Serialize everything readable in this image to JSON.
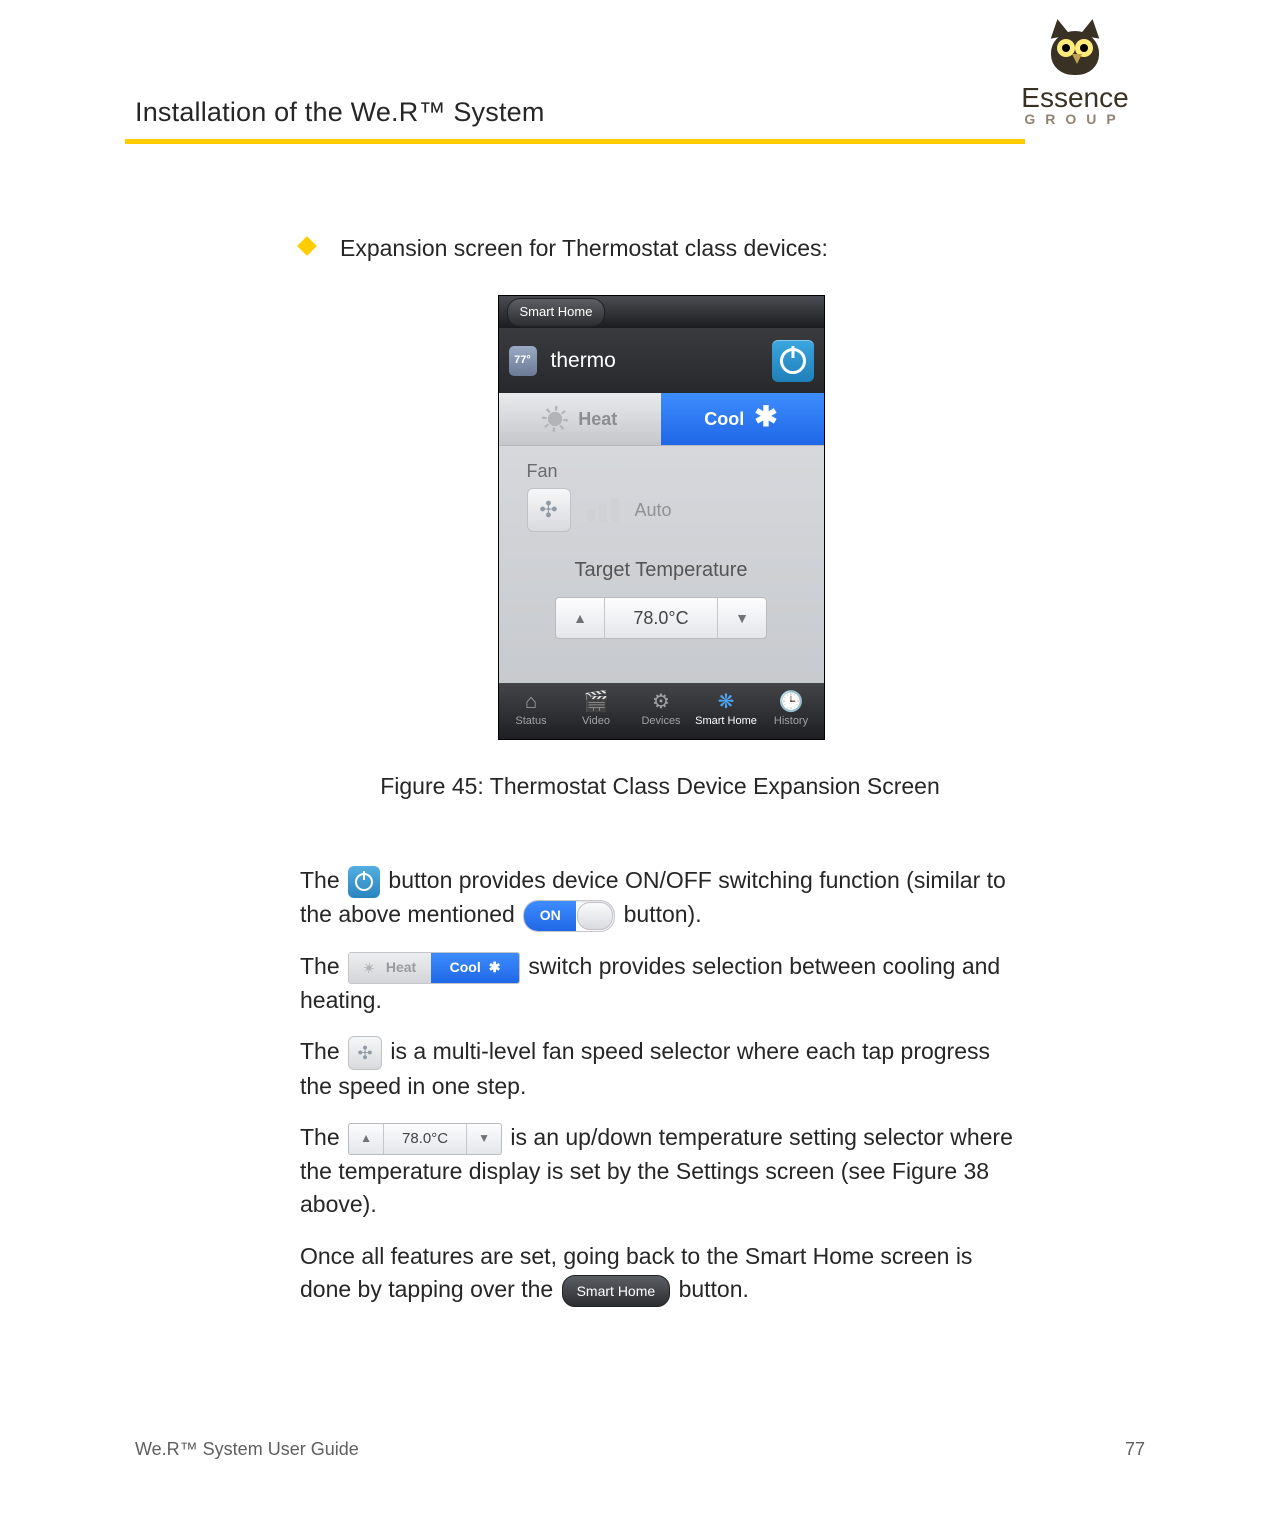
{
  "header": {
    "doc_title": "Installation of the We.R™ System"
  },
  "logo": {
    "brand": "Essence",
    "group": "GROUP"
  },
  "bullet": {
    "text": "Expansion screen for Thermostat class devices:"
  },
  "phone": {
    "top_tab": "Smart Home",
    "device_name": "thermo",
    "thermo_badge": "77°",
    "heat_label": "Heat",
    "cool_label": "Cool",
    "fan_label": "Fan",
    "auto_label": "Auto",
    "target_label": "Target Temperature",
    "target_value": "78.0°C",
    "tabs": [
      "Status",
      "Video",
      "Devices",
      "Smart Home",
      "History"
    ],
    "tab_icons": [
      "⌂",
      "🎬",
      "⚙",
      "❋",
      "🕒"
    ]
  },
  "caption": "Figure 45: Thermostat Class Device Expansion Screen",
  "para1": {
    "a": "The ",
    "b": " button provides device ON/OFF switching function (similar to the above mentioned ",
    "c": " button)."
  },
  "on_label": "ON",
  "para2": {
    "a": "The ",
    "b": " switch provides selection between cooling and heating."
  },
  "inline_seg": {
    "heat": "Heat",
    "cool": "Cool"
  },
  "para3": {
    "a": "The ",
    "b": " is a multi-level fan speed selector where each tap progress the speed in one step."
  },
  "para4": {
    "a": "The ",
    "b": " is an up/down temperature setting selector where the temperature display is set by the Settings screen (see Figure 38 above)."
  },
  "inline_step_value": "78.0°C",
  "para5": {
    "a": "Once all features are set, going back to the Smart Home screen is done by tapping over the ",
    "b": " button."
  },
  "inline_smarthome": "Smart Home",
  "footer": {
    "left": "We.R™ System User Guide",
    "page": "77"
  }
}
